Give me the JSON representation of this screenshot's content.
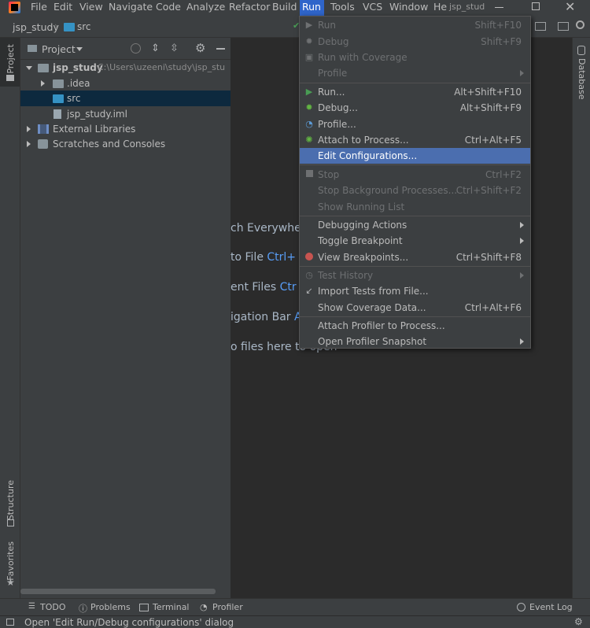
{
  "menubar": {
    "items": [
      "File",
      "Edit",
      "View",
      "Navigate",
      "Code",
      "Analyze",
      "Refactor",
      "Build",
      "Run",
      "Tools",
      "VCS",
      "Window",
      "He"
    ],
    "window_title": "jsp_stud"
  },
  "breadcrumb": {
    "project": "jsp_study",
    "folder": "src"
  },
  "left_tabs": {
    "project": "Project",
    "structure": "Structure",
    "favorites": "Favorites"
  },
  "right_tabs": {
    "database": "Database"
  },
  "project_panel": {
    "title": "Project",
    "tree": [
      {
        "label": "jsp_study",
        "path": "C:\\Users\\uzeeni\\study\\jsp_stu"
      },
      {
        "label": ".idea"
      },
      {
        "label": "src"
      },
      {
        "label": "jsp_study.iml"
      },
      {
        "label": "External Libraries"
      },
      {
        "label": "Scratches and Consoles"
      }
    ]
  },
  "editor_hints": [
    {
      "text": "ch Everywhe",
      "key": ""
    },
    {
      "text": "to File",
      "key": "Ctrl+"
    },
    {
      "text": "ent Files",
      "key": "Ctr"
    },
    {
      "text": "igation Bar",
      "key": "A"
    },
    {
      "text": "o files here to open",
      "key": ""
    }
  ],
  "run_menu": {
    "items": [
      {
        "label": "Run",
        "shortcut": "Shift+F10"
      },
      {
        "label": "Debug",
        "shortcut": "Shift+F9"
      },
      {
        "label": "Run with Coverage",
        "shortcut": ""
      },
      {
        "label": "Profile",
        "shortcut": ""
      },
      {
        "label": "Run...",
        "shortcut": "Alt+Shift+F10"
      },
      {
        "label": "Debug...",
        "shortcut": "Alt+Shift+F9"
      },
      {
        "label": "Profile...",
        "shortcut": ""
      },
      {
        "label": "Attach to Process...",
        "shortcut": "Ctrl+Alt+F5"
      },
      {
        "label": "Edit Configurations...",
        "shortcut": ""
      },
      {
        "label": "Stop",
        "shortcut": "Ctrl+F2"
      },
      {
        "label": "Stop Background Processes...",
        "shortcut": "Ctrl+Shift+F2"
      },
      {
        "label": "Show Running List",
        "shortcut": ""
      },
      {
        "label": "Debugging Actions",
        "shortcut": ""
      },
      {
        "label": "Toggle Breakpoint",
        "shortcut": ""
      },
      {
        "label": "View Breakpoints...",
        "shortcut": "Ctrl+Shift+F8"
      },
      {
        "label": "Test History",
        "shortcut": ""
      },
      {
        "label": "Import Tests from File...",
        "shortcut": ""
      },
      {
        "label": "Show Coverage Data...",
        "shortcut": "Ctrl+Alt+F6"
      },
      {
        "label": "Attach Profiler to Process...",
        "shortcut": ""
      },
      {
        "label": "Open Profiler Snapshot",
        "shortcut": ""
      }
    ]
  },
  "bottom_bar": {
    "todo": "TODO",
    "problems": "Problems",
    "terminal": "Terminal",
    "profiler": "Profiler",
    "event_log": "Event Log"
  },
  "status": {
    "text": "Open 'Edit Run/Debug configurations' dialog"
  },
  "colors": {
    "accent": "#2f65ca",
    "selection": "#4b6eaf",
    "run_green": "#499c54",
    "debug_green": "#62b543",
    "stop_red": "#c75450"
  }
}
